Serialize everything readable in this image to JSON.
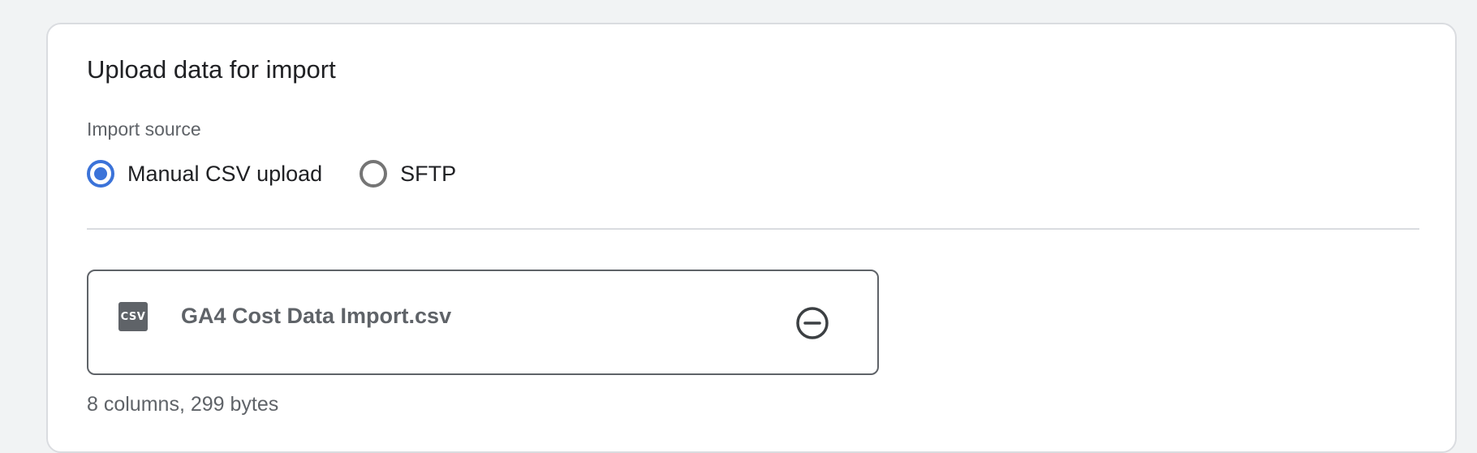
{
  "card": {
    "title": "Upload data for import"
  },
  "import_source": {
    "label": "Import source",
    "options": [
      {
        "label": "Manual CSV upload",
        "selected": true
      },
      {
        "label": "SFTP",
        "selected": false
      }
    ],
    "accent_color": "#3b73d9"
  },
  "file": {
    "icon": "csv-file-icon",
    "icon_text": "CSV",
    "name": "GA4 Cost Data Import.csv",
    "remove_icon": "remove-circle-icon",
    "meta": "8 columns, 299 bytes"
  }
}
